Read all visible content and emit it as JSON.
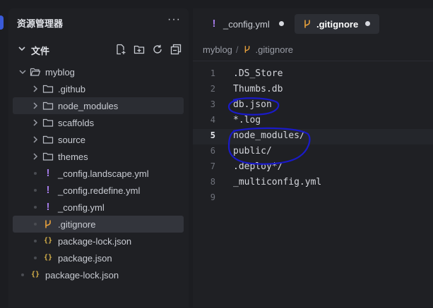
{
  "explorer": {
    "title": "资源管理器",
    "more": "···",
    "section_label": "文件"
  },
  "tree": [
    {
      "name": "myblog",
      "kind": "folder",
      "expanded": true
    },
    {
      "name": ".github",
      "kind": "folder"
    },
    {
      "name": "node_modules",
      "kind": "folder"
    },
    {
      "name": "scaffolds",
      "kind": "folder"
    },
    {
      "name": "source",
      "kind": "folder"
    },
    {
      "name": "themes",
      "kind": "folder"
    },
    {
      "name": "_config.landscape.yml",
      "kind": "yml"
    },
    {
      "name": "_config.redefine.yml",
      "kind": "yml"
    },
    {
      "name": "_config.yml",
      "kind": "yml"
    },
    {
      "name": ".gitignore",
      "kind": "git"
    },
    {
      "name": "package-lock.json",
      "kind": "json"
    },
    {
      "name": "package.json",
      "kind": "json"
    },
    {
      "name": "package-lock.json",
      "kind": "json"
    }
  ],
  "tabs": [
    {
      "label": "_config.yml",
      "icon": "yaml-icon",
      "active": false,
      "modified": true
    },
    {
      "label": ".gitignore",
      "icon": "git-branch-icon",
      "active": true,
      "modified": true
    }
  ],
  "breadcrumb": {
    "folder": "myblog",
    "separator": "/",
    "file": ".gitignore"
  },
  "editor": {
    "current_line": 5,
    "lines": [
      {
        "n": "1",
        "text": ".DS_Store"
      },
      {
        "n": "2",
        "text": "Thumbs.db"
      },
      {
        "n": "3",
        "text": "db.json"
      },
      {
        "n": "4",
        "text": "*.log"
      },
      {
        "n": "5",
        "text": "node_modules/"
      },
      {
        "n": "6",
        "text": "public/"
      },
      {
        "n": "7",
        "text": ".deploy*/"
      },
      {
        "n": "8",
        "text": "_multiconfig.yml"
      },
      {
        "n": "9",
        "text": ""
      }
    ]
  },
  "colors": {
    "yml_icon": "#a47be8",
    "git_icon": "#e8a13c",
    "json_icon": "#d8b24a",
    "annotation_ink": "#1a1ac8",
    "accent": "#3a5bd9"
  }
}
